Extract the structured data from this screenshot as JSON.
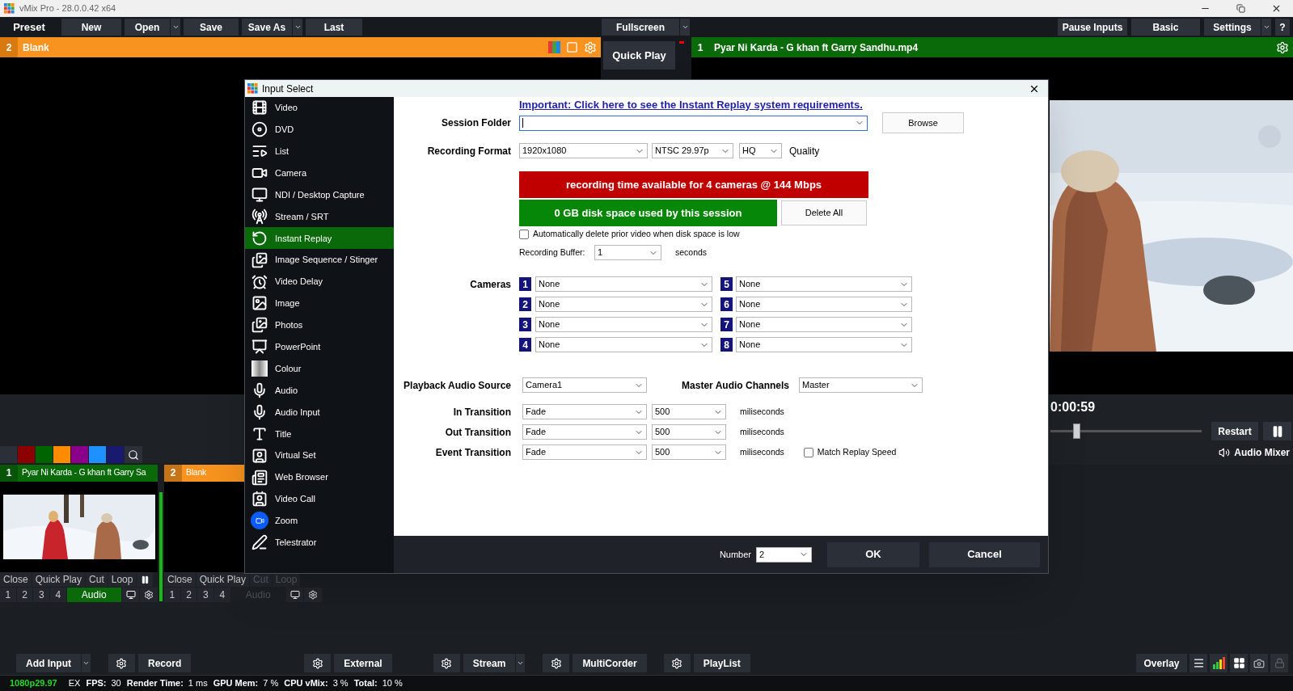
{
  "window": {
    "title": "vMix Pro - 28.0.0.42 x64"
  },
  "toolbar": {
    "preset": "Preset",
    "left_buttons": [
      {
        "label": "New",
        "dropdown": false
      },
      {
        "label": "Open",
        "dropdown": true
      },
      {
        "label": "Save",
        "dropdown": false
      },
      {
        "label": "Save As",
        "dropdown": true
      },
      {
        "label": "Last",
        "dropdown": false
      }
    ],
    "center_button": {
      "label": "Fullscreen",
      "dropdown": true
    },
    "right_buttons": [
      {
        "label": "Pause Inputs",
        "dropdown": false
      },
      {
        "label": "Basic",
        "dropdown": false
      },
      {
        "label": "Settings",
        "dropdown": true
      },
      {
        "label": "?",
        "dropdown": false
      }
    ]
  },
  "preview": {
    "number": "2",
    "title": "Blank"
  },
  "quick_play": "Quick Play",
  "output": {
    "number": "1",
    "title": "Pyar Ni Karda - G khan ft Garry Sandhu.mp4",
    "time": "0:00:59",
    "level": 0.17,
    "restart": "Restart",
    "audio_mixer": "Audio Mixer"
  },
  "color_filters": [
    {
      "color": "#2b3038"
    },
    {
      "color": "#8b0000"
    },
    {
      "color": "#006400"
    },
    {
      "color": "#ff8c00"
    },
    {
      "color": "#8b008b"
    },
    {
      "color": "#1e90ff"
    },
    {
      "color": "#191970"
    }
  ],
  "inputs": [
    {
      "number": "1",
      "title": "Pyar Ni Karda - G khan ft Garry Sa",
      "color": "#0a6a0a",
      "thumbnail": {
        "kind": "picture"
      },
      "controls": [
        {
          "label": "Close",
          "disabled": false
        },
        {
          "label": "Quick Play",
          "disabled": false
        },
        {
          "label": "Cut",
          "disabled": false
        },
        {
          "label": "Loop",
          "disabled": false
        }
      ],
      "pause_button": true,
      "buses": [
        "1",
        "2",
        "3",
        "4"
      ],
      "audio": {
        "label": "Audio",
        "on": true
      }
    },
    {
      "number": "2",
      "title": "Blank",
      "color": "#f7931e",
      "controls": [
        {
          "label": "Close",
          "disabled": false
        },
        {
          "label": "Quick Play",
          "disabled": false
        },
        {
          "label": "Cut",
          "disabled": true
        },
        {
          "label": "Loop",
          "disabled": true
        }
      ],
      "pause_button": false,
      "buses": [
        "1",
        "2",
        "3",
        "4"
      ],
      "audio": {
        "label": "Audio",
        "on": false
      }
    }
  ],
  "dialog": {
    "title": "Input Select",
    "categories": [
      {
        "label": "Video",
        "selected": false
      },
      {
        "label": "DVD",
        "selected": false
      },
      {
        "label": "List",
        "selected": false
      },
      {
        "label": "Camera",
        "selected": false
      },
      {
        "label": "NDI / Desktop Capture",
        "selected": false
      },
      {
        "label": "Stream / SRT",
        "selected": false
      },
      {
        "label": "Instant Replay",
        "selected": true
      },
      {
        "label": "Image Sequence / Stinger",
        "selected": false
      },
      {
        "label": "Video Delay",
        "selected": false
      },
      {
        "label": "Image",
        "selected": false
      },
      {
        "label": "Photos",
        "selected": false
      },
      {
        "label": "PowerPoint",
        "selected": false
      },
      {
        "label": "Colour",
        "selected": false
      },
      {
        "label": "Audio",
        "selected": false
      },
      {
        "label": "Audio Input",
        "selected": false
      },
      {
        "label": "Title",
        "selected": false
      },
      {
        "label": "Virtual Set",
        "selected": false
      },
      {
        "label": "Web Browser",
        "selected": false
      },
      {
        "label": "Video Call",
        "selected": false
      },
      {
        "label": "Zoom",
        "selected": false
      },
      {
        "label": "Telestrator",
        "selected": false
      }
    ],
    "link": "Important: Click here to see the Instant Replay system requirements.",
    "session_folder": {
      "label": "Session Folder"
    },
    "browse": "Browse",
    "recording_format": {
      "label": "Recording Format",
      "resolution": "1920x1080",
      "frame_rate": "NTSC 29.97p",
      "quality": "HQ",
      "quality_label": "Quality"
    },
    "time_banner": "recording time available for 4 cameras @ 144 Mbps",
    "disk_banner": "0 GB disk space used by this session",
    "delete_all": "Delete All",
    "auto_delete": {
      "label": "Automatically delete prior video when disk space is low",
      "checked": false
    },
    "recording_buffer": {
      "label": "Recording Buffer:",
      "value": "1",
      "unit": "seconds"
    },
    "cameras": {
      "label": "Cameras",
      "items": [
        {
          "number": "1",
          "value": "None"
        },
        {
          "number": "2",
          "value": "None"
        },
        {
          "number": "3",
          "value": "None"
        },
        {
          "number": "4",
          "value": "None"
        },
        {
          "number": "5",
          "value": "None"
        },
        {
          "number": "6",
          "value": "None"
        },
        {
          "number": "7",
          "value": "None"
        },
        {
          "number": "8",
          "value": "None"
        }
      ]
    },
    "playback_audio_source": {
      "label": "Playback Audio Source",
      "value": "Camera1"
    },
    "master_audio_channels": {
      "label": "Master Audio Channels",
      "value": "Master"
    },
    "transitions": [
      {
        "label": "In Transition",
        "type": "Fade",
        "duration": "500",
        "unit": "miliseconds"
      },
      {
        "label": "Out Transition",
        "type": "Fade",
        "duration": "500",
        "unit": "miliseconds"
      },
      {
        "label": "Event Transition",
        "type": "Fade",
        "duration": "500",
        "unit": "miliseconds"
      }
    ],
    "match_replay_speed": {
      "label": "Match Replay Speed",
      "checked": false
    },
    "number": {
      "label": "Number",
      "value": "2"
    },
    "ok": "OK",
    "cancel": "Cancel"
  },
  "bottom_bar": {
    "groups": [
      {
        "label": "Add Input",
        "dropdown": true,
        "gear": false
      },
      {
        "label": "Record",
        "dropdown": false,
        "gear": true
      },
      {
        "label": "External",
        "dropdown": false,
        "gear": true
      },
      {
        "label": "Stream",
        "dropdown": true,
        "gear": true
      },
      {
        "label": "MultiCorder",
        "dropdown": false,
        "gear": true
      },
      {
        "label": "PlayList",
        "dropdown": false,
        "gear": true
      }
    ],
    "overlay": "Overlay"
  },
  "status_bar": {
    "format": "1080p29.97",
    "mode": "EX",
    "stats": [
      {
        "label": "FPS:",
        "value": "30"
      },
      {
        "label": "Render Time:",
        "value": "1 ms"
      },
      {
        "label": "GPU Mem:",
        "value": "7 %"
      },
      {
        "label": "CPU vMix:",
        "value": "3 %"
      },
      {
        "label": "Total:",
        "value": "10 %"
      }
    ]
  }
}
